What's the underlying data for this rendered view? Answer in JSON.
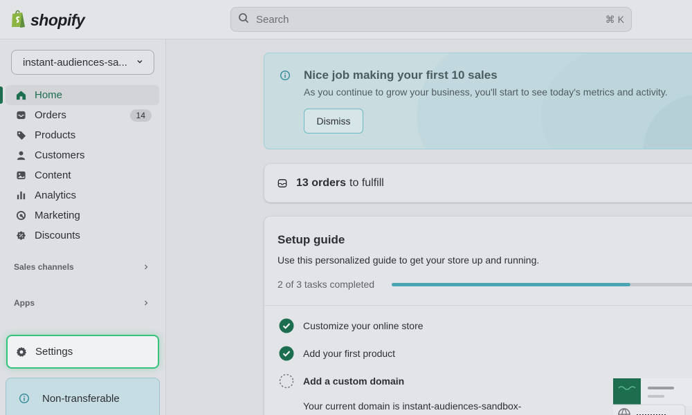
{
  "topbar": {
    "brand": "shopify",
    "search_placeholder": "Search",
    "search_shortcut": "⌘ K"
  },
  "sidebar": {
    "store_name": "instant-audiences-sa...",
    "items": [
      {
        "label": "Home",
        "icon": "home-icon"
      },
      {
        "label": "Orders",
        "icon": "inbox-icon",
        "badge": "14"
      },
      {
        "label": "Products",
        "icon": "tag-icon"
      },
      {
        "label": "Customers",
        "icon": "person-icon"
      },
      {
        "label": "Content",
        "icon": "image-icon"
      },
      {
        "label": "Analytics",
        "icon": "bar-chart-icon"
      },
      {
        "label": "Marketing",
        "icon": "target-icon"
      },
      {
        "label": "Discounts",
        "icon": "discount-icon"
      }
    ],
    "sales_channels": "Sales channels",
    "apps": "Apps",
    "settings": "Settings",
    "non_transferable": "Non-transferable"
  },
  "banner": {
    "title": "Nice job making your first 10 sales",
    "text": "As you continue to grow your business, you'll start to see today's metrics and activity.",
    "dismiss": "Dismiss"
  },
  "orders": {
    "count": "13 orders",
    "rest": "to fulfill"
  },
  "setup": {
    "title": "Setup guide",
    "description": "Use this personalized guide to get your store up and running.",
    "progress_text": "2 of 3 tasks completed",
    "progress_fraction": 0.75,
    "tasks": [
      {
        "label": "Customize your online store",
        "done": true
      },
      {
        "label": "Add your first product",
        "done": true
      },
      {
        "label": "Add a custom domain",
        "done": false
      }
    ],
    "domain_text": "Your current domain is instant-audiences-sandbox-"
  },
  "colors": {
    "brand_green": "#1d6e4f",
    "check_green": "#1d6e4f",
    "progress": "#4aa6b5",
    "settings_border": "#35c27a"
  }
}
